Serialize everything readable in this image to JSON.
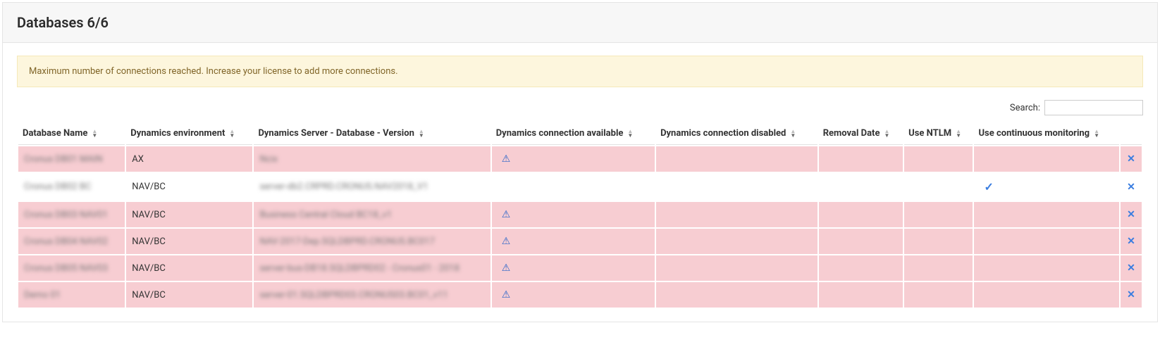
{
  "panel": {
    "title": "Databases 6/6"
  },
  "alert": {
    "message": "Maximum number of connections reached. Increase your license to add more connections."
  },
  "toolbar": {
    "search_label": "Search:",
    "search_value": ""
  },
  "columns": {
    "name": "Database Name",
    "env": "Dynamics environment",
    "server": "Dynamics Server - Database - Version",
    "conn_avail": "Dynamics connection available",
    "conn_disabled": "Dynamics connection disabled",
    "removal": "Removal Date",
    "ntlm": "Use NTLM",
    "continuous": "Use continuous monitoring"
  },
  "rows": [
    {
      "name_text": "Cronus DB01 MAIN",
      "env": "AX",
      "server": "Ncix",
      "warn": true,
      "check_cont": false,
      "error": true
    },
    {
      "name_text": "Cronus DB02 BC",
      "env": "NAV/BC",
      "server": "server-db2.CRPRD.CRONUS.NAV2018_V1",
      "warn": false,
      "check_cont": true,
      "error": false
    },
    {
      "name_text": "Cronus DB03 NAV01",
      "env": "NAV/BC",
      "server": "Business Central Cloud BC18_v1",
      "warn": true,
      "check_cont": false,
      "error": true
    },
    {
      "name_text": "Cronus DB04 NAV02",
      "env": "NAV/BC",
      "server": "NAV-2017-Dep.SQLDBPRD.CRONUS.BC017",
      "warn": true,
      "check_cont": false,
      "error": true
    },
    {
      "name_text": "Cronus DB05 NAV03",
      "env": "NAV/BC",
      "server": "server-bus-DB18.SQLDBPRD02 - Cronus01 - 2018",
      "warn": true,
      "check_cont": false,
      "error": true
    },
    {
      "name_text": "Demo 01",
      "env": "NAV/BC",
      "server": "server-01.SQLDBPRD03.CRONUS03.BC01_v11",
      "warn": true,
      "check_cont": false,
      "error": true
    }
  ]
}
